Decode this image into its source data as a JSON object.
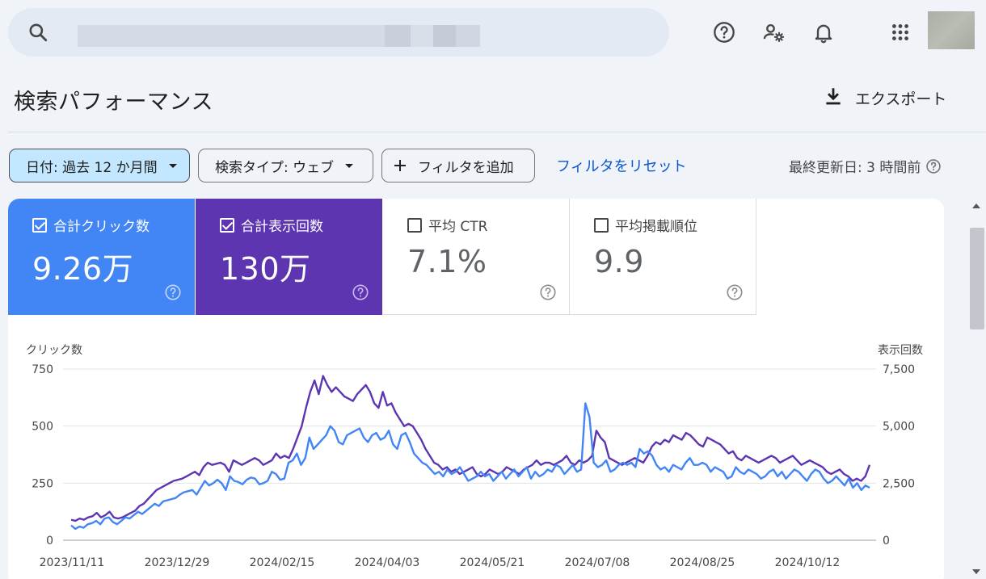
{
  "header": {
    "search_placeholder": "",
    "icons": [
      "search-icon",
      "help-icon",
      "manage-accounts-icon",
      "notifications-icon",
      "apps-icon"
    ]
  },
  "page": {
    "title": "検索パフォーマンス",
    "export_label": "エクスポート"
  },
  "filters": {
    "date_chip": "日付: 過去 12 か月間",
    "type_chip": "検索タイプ: ウェブ",
    "add_filter": "フィルタを追加",
    "reset": "フィルタをリセット",
    "last_updated": "最終更新日: 3 時間前"
  },
  "metrics": [
    {
      "label": "合計クリック数",
      "value": "9.26万",
      "checked": true,
      "color": "#4285f4"
    },
    {
      "label": "合計表示回数",
      "value": "130万",
      "checked": true,
      "color": "#5e35b1"
    },
    {
      "label": "平均 CTR",
      "value": "7.1%",
      "checked": false
    },
    {
      "label": "平均掲載順位",
      "value": "9.9",
      "checked": false
    }
  ],
  "chart_data": {
    "type": "line",
    "left_axis_label": "クリック数",
    "right_axis_label": "表示回数",
    "ylim_left": [
      0,
      750
    ],
    "ylim_right": [
      0,
      7500
    ],
    "left_ticks": [
      "0",
      "250",
      "500",
      "750"
    ],
    "right_ticks": [
      "0",
      "2,500",
      "5,000",
      "7,500"
    ],
    "x_ticks": [
      "2023/11/11",
      "2023/12/29",
      "2024/02/15",
      "2024/04/03",
      "2024/05/21",
      "2024/07/08",
      "2024/08/25",
      "2024/10/12"
    ],
    "grid": true,
    "series": [
      {
        "name": "合計クリック数",
        "axis": "left",
        "color": "#4285f4",
        "values": [
          65,
          50,
          60,
          55,
          70,
          75,
          85,
          70,
          95,
          100,
          80,
          70,
          85,
          100,
          95,
          110,
          125,
          115,
          130,
          145,
          160,
          150,
          170,
          175,
          180,
          185,
          200,
          210,
          215,
          220,
          200,
          230,
          260,
          240,
          250,
          265,
          250,
          220,
          280,
          260,
          255,
          245,
          265,
          275,
          270,
          245,
          250,
          260,
          300,
          290,
          265,
          270,
          340,
          350,
          380,
          330,
          360,
          450,
          400,
          420,
          440,
          460,
          500,
          480,
          430,
          420,
          460,
          470,
          480,
          490,
          450,
          430,
          460,
          470,
          440,
          450,
          480,
          420,
          400,
          460,
          470,
          430,
          380,
          360,
          340,
          330,
          310,
          290,
          300,
          280,
          310,
          290,
          300,
          320,
          290,
          260,
          270,
          280,
          300,
          280,
          290,
          260,
          280,
          300,
          270,
          290,
          310,
          280,
          300,
          320,
          270,
          300,
          280,
          290,
          310,
          300,
          330,
          320,
          290,
          310,
          330,
          300,
          310,
          600,
          540,
          340,
          320,
          330,
          350,
          300,
          310,
          330,
          340,
          330,
          340,
          320,
          400,
          380,
          390,
          370,
          330,
          310,
          320,
          300,
          330,
          320,
          310,
          340,
          360,
          330,
          330,
          340,
          330,
          300,
          320,
          310,
          300,
          270,
          280,
          320,
          300,
          290,
          310,
          300,
          290,
          270,
          280,
          300,
          310,
          280,
          300,
          270,
          290,
          310,
          300,
          280,
          260,
          290,
          310,
          300,
          270,
          250,
          260,
          280,
          260,
          240,
          270,
          230,
          250,
          220,
          240,
          230
        ]
      },
      {
        "name": "合計表示回数",
        "axis": "right",
        "color": "#5e35b1",
        "values": [
          900,
          850,
          950,
          900,
          1000,
          1050,
          1200,
          1000,
          1100,
          1250,
          1000,
          950,
          1000,
          1100,
          1200,
          1300,
          1500,
          1600,
          1800,
          2000,
          2200,
          2300,
          2400,
          2500,
          2600,
          2650,
          2700,
          2800,
          2900,
          3000,
          2850,
          3200,
          3400,
          3300,
          3350,
          3400,
          3300,
          3000,
          3500,
          3400,
          3300,
          3400,
          3500,
          3600,
          3500,
          3300,
          3400,
          3500,
          3800,
          3600,
          3700,
          3600,
          4000,
          4500,
          5000,
          5800,
          6500,
          7000,
          6400,
          7200,
          6800,
          6500,
          6700,
          6500,
          6300,
          6200,
          6100,
          6400,
          6600,
          6800,
          6500,
          6000,
          5800,
          6500,
          5900,
          6000,
          5600,
          5300,
          5000,
          5100,
          5000,
          4700,
          4400,
          4000,
          3700,
          3400,
          3300,
          3100,
          3200,
          3000,
          3100,
          2900,
          3000,
          3100,
          3200,
          2900,
          2800,
          2900,
          3100,
          3000,
          2900,
          3000,
          3200,
          3100,
          3000,
          2900,
          3100,
          3200,
          3300,
          3500,
          3300,
          3400,
          3400,
          3300,
          3400,
          3500,
          3700,
          3400,
          3300,
          3500,
          3400,
          3500,
          3700,
          4800,
          4500,
          4300,
          3600,
          3500,
          3400,
          3300,
          3400,
          3500,
          3600,
          3500,
          3400,
          3700,
          4100,
          4300,
          4200,
          4400,
          4300,
          4600,
          4500,
          4400,
          4700,
          4600,
          4400,
          4200,
          4100,
          4500,
          4400,
          4300,
          4200,
          4000,
          3800,
          3900,
          3600,
          3500,
          3700,
          3600,
          3500,
          3400,
          3500,
          3600,
          3700,
          3600,
          3400,
          3500,
          3600,
          3700,
          3500,
          3300,
          3400,
          3500,
          3400,
          3300,
          3200,
          3000,
          2900,
          3000,
          3100,
          2900,
          2800,
          2600,
          2700,
          2600,
          2800,
          3300
        ]
      }
    ]
  }
}
